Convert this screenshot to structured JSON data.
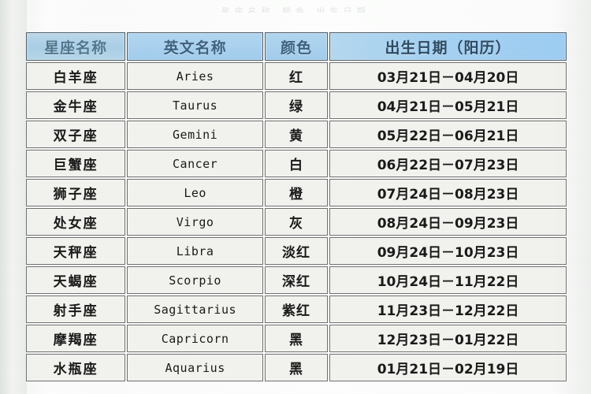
{
  "page": {
    "top_cut_text": "星座名称  颜色  出生日期"
  },
  "table": {
    "headers": {
      "name": "星座名称",
      "english": "英文名称",
      "color": "颜色",
      "birthdate": "出生日期（阳历）"
    },
    "rows": [
      {
        "name": "白羊座",
        "english": "Aries",
        "color": "红",
        "birthdate": "03月21日－04月20日"
      },
      {
        "name": "金牛座",
        "english": "Taurus",
        "color": "绿",
        "birthdate": "04月21日－05月21日"
      },
      {
        "name": "双子座",
        "english": "Gemini",
        "color": "黄",
        "birthdate": "05月22日－06月21日"
      },
      {
        "name": "巨蟹座",
        "english": "Cancer",
        "color": "白",
        "birthdate": "06月22日－07月23日"
      },
      {
        "name": "狮子座",
        "english": "Leo",
        "color": "橙",
        "birthdate": "07月24日－08月23日"
      },
      {
        "name": "处女座",
        "english": "Virgo",
        "color": "灰",
        "birthdate": "08月24日－09月23日"
      },
      {
        "name": "天秤座",
        "english": "Libra",
        "color": "淡红",
        "birthdate": "09月24日－10月23日"
      },
      {
        "name": "天蝎座",
        "english": "Scorpio",
        "color": "深红",
        "birthdate": "10月24日－11月22日"
      },
      {
        "name": "射手座",
        "english": "Sagittarius",
        "color": "紫红",
        "birthdate": "11月23日－12月22日"
      },
      {
        "name": "摩羯座",
        "english": "Capricorn",
        "color": "黑",
        "birthdate": "12月23日－01月22日"
      },
      {
        "name": "水瓶座",
        "english": "Aquarius",
        "color": "黑",
        "birthdate": "01月21日－02月19日"
      }
    ]
  },
  "colors": {
    "header_blue": "#9ecdf3",
    "header_blue_faded": "#b2d6ef",
    "cell_background": "#f2f2ee",
    "border": "#6d6f6d",
    "page_background": "#fafbfa"
  }
}
